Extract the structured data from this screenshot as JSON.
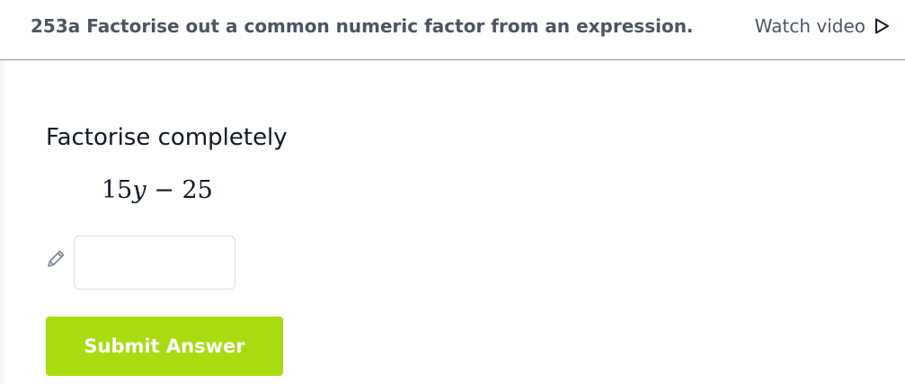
{
  "header": {
    "title": "253a Factorise out a common numeric factor from an expression.",
    "watch_video_label": "Watch video",
    "play_icon": "play-triangle-icon"
  },
  "question": {
    "prompt": "Factorise completely",
    "expression": {
      "coefficient": "15",
      "variable": "y",
      "operator": "−",
      "constant": "25"
    }
  },
  "answer": {
    "input_value": "",
    "placeholder": "",
    "edit_icon": "pencil-icon"
  },
  "actions": {
    "submit_label": "Submit Answer"
  },
  "colors": {
    "submit_background": "#a8dc10",
    "header_text": "#4d5563",
    "divider": "#8a8f98"
  }
}
